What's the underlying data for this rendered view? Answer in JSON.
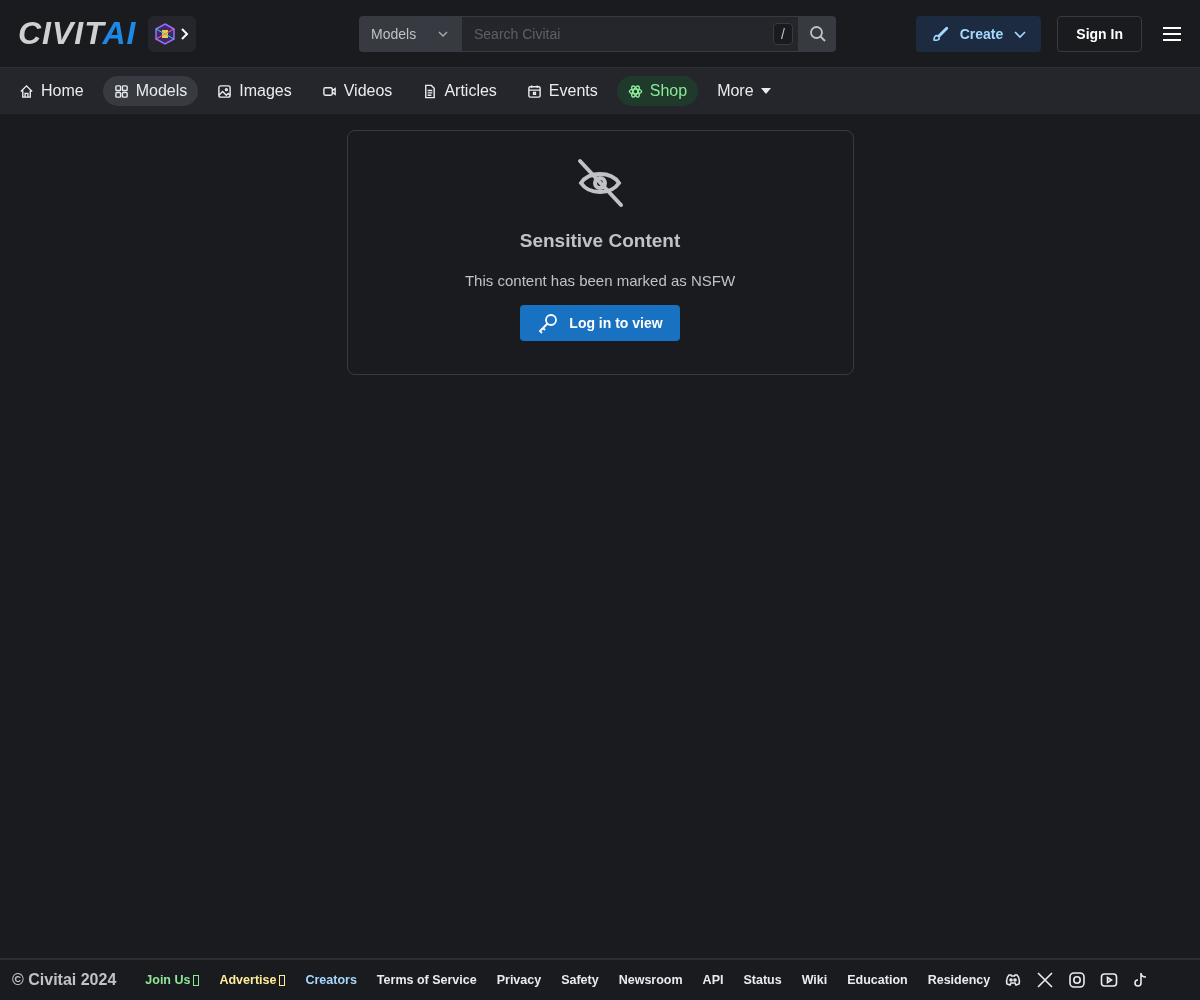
{
  "header": {
    "logo": {
      "main": "CIVIT",
      "accent": "AI"
    },
    "search": {
      "scope": "Models",
      "placeholder": "Search Civitai",
      "shortcut": "/"
    },
    "create_button": "Create",
    "sign_in_button": "Sign In"
  },
  "nav": [
    {
      "label": "Home",
      "selected": false,
      "kind": "link"
    },
    {
      "label": "Models",
      "selected": true,
      "kind": "link"
    },
    {
      "label": "Images",
      "selected": false,
      "kind": "link"
    },
    {
      "label": "Videos",
      "selected": false,
      "kind": "link"
    },
    {
      "label": "Articles",
      "selected": false,
      "kind": "link"
    },
    {
      "label": "Events",
      "selected": false,
      "kind": "link"
    },
    {
      "label": "Shop",
      "selected": false,
      "kind": "shop"
    },
    {
      "label": "More",
      "selected": false,
      "kind": "menu"
    }
  ],
  "notice": {
    "title": "Sensitive Content",
    "message": "This content has been marked as NSFW",
    "button": "Log in to view"
  },
  "footer": {
    "copyright": "© Civitai 2024",
    "links": [
      {
        "label": "Join Us",
        "color": "#8ce99a",
        "external": true
      },
      {
        "label": "Advertise",
        "color": "#ffec99",
        "external": true
      },
      {
        "label": "Creators",
        "color": "#a5d8ff",
        "external": false
      },
      {
        "label": "Terms of Service",
        "color": "#e9ecef",
        "external": false
      },
      {
        "label": "Privacy",
        "color": "#e9ecef",
        "external": false
      },
      {
        "label": "Safety",
        "color": "#e9ecef",
        "external": false
      },
      {
        "label": "Newsroom",
        "color": "#e9ecef",
        "external": false
      },
      {
        "label": "API",
        "color": "#e9ecef",
        "external": false
      },
      {
        "label": "Status",
        "color": "#e9ecef",
        "external": false
      },
      {
        "label": "Wiki",
        "color": "#e9ecef",
        "external": false
      },
      {
        "label": "Education",
        "color": "#e9ecef",
        "external": false
      },
      {
        "label": "Residency",
        "color": "#e9ecef",
        "external": false
      }
    ]
  }
}
